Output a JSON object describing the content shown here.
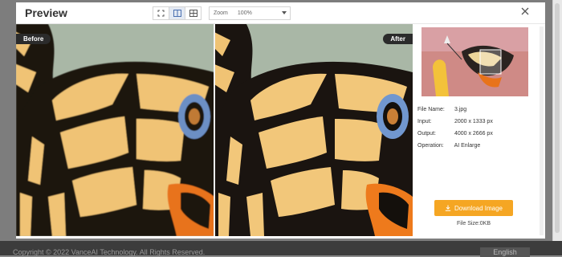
{
  "modal": {
    "title": "Preview",
    "zoom_label": "Zoom",
    "zoom_value": "100%",
    "view_modes": [
      "fit-icon",
      "split-icon",
      "grid-icon"
    ],
    "active_view_mode": "split-icon"
  },
  "labels": {
    "before": "Before",
    "after": "After"
  },
  "file_info": {
    "file_name_key": "File Name:",
    "file_name": "3.jpg",
    "input_key": "Input:",
    "input": "2000 x 1333 px",
    "output_key": "Output:",
    "output": "4000 x 2666 px",
    "operation_key": "Operation:",
    "operation": "AI Enlarge"
  },
  "download": {
    "label": "Download Image",
    "file_size": "File Size:0KB"
  },
  "background_page": {
    "footer_text": "Copyright © 2022 VanceAI Technology. All Rights Reserved.",
    "language": "English"
  },
  "colors": {
    "accent": "#f5a623",
    "badge": "#2b2b2b",
    "wing_yellow": "#f0c374",
    "wing_black": "#1a1410",
    "wing_orange": "#e8731a",
    "wing_blue": "#6c8fc4",
    "background_green": "#a9b7a6"
  }
}
